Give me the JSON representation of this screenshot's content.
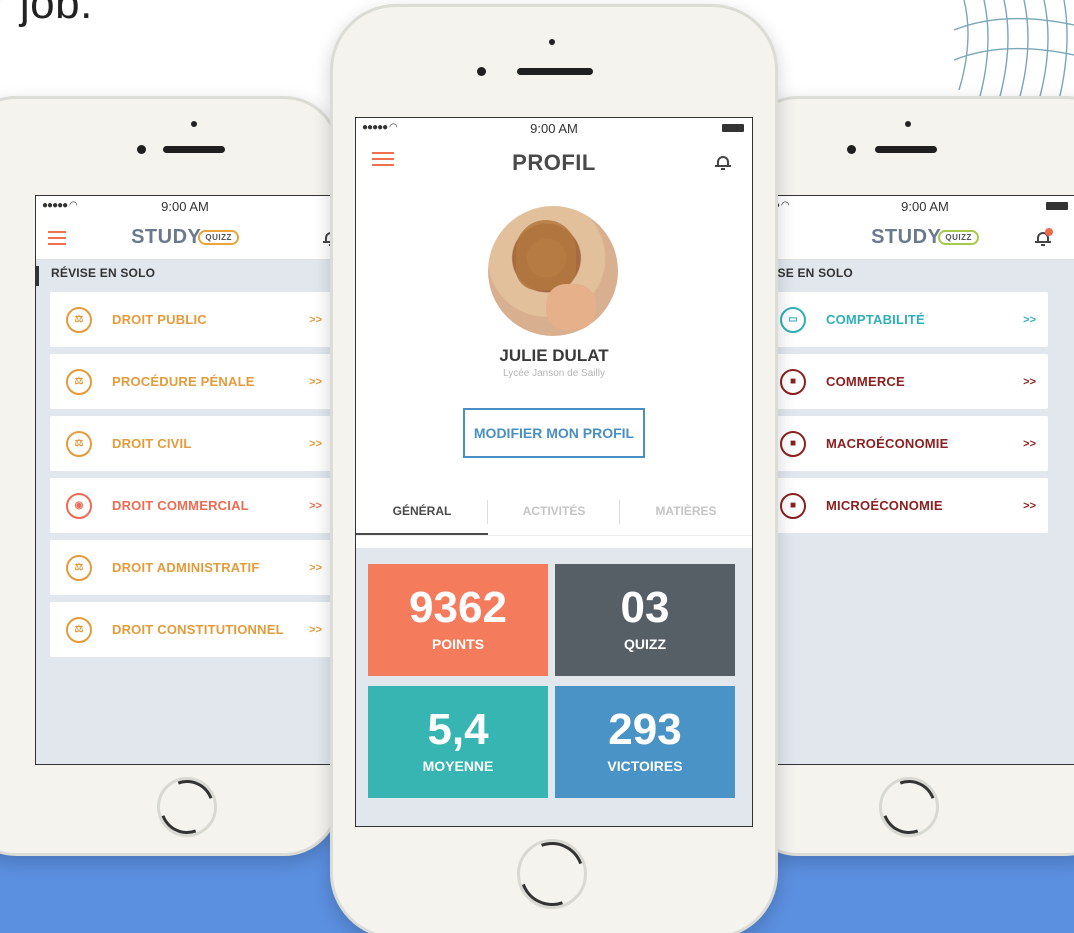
{
  "background": {
    "headline": "r job."
  },
  "colors": {
    "orange": "#e39b3c",
    "coral": "#ef6a52",
    "teal": "#2fb0b8",
    "maroon": "#8c2020",
    "blue": "#4a8fc4",
    "dark": "#565e66"
  },
  "left_phone": {
    "status_time": "9:00 AM",
    "logo": "STUDY",
    "logo_badge": "QUIZZ",
    "section_title": "RÉVISE EN SOLO",
    "items": [
      {
        "label": "DROIT PUBLIC",
        "icon": "scales-icon",
        "chevron": ">>"
      },
      {
        "label": "PROCÉDURE PÉNALE",
        "icon": "scales-icon",
        "chevron": ">>"
      },
      {
        "label": "DROIT CIVIL",
        "icon": "scales-icon",
        "chevron": ">>"
      },
      {
        "label": "DROIT COMMERCIAL",
        "icon": "globe-icon",
        "chevron": ">>"
      },
      {
        "label": "DROIT ADMINISTRATIF",
        "icon": "scales-icon",
        "chevron": ">>"
      },
      {
        "label": "DROIT CONSTITUTIONNEL",
        "icon": "scales-icon",
        "chevron": ">>"
      }
    ]
  },
  "center_phone": {
    "status_time": "9:00 AM",
    "title": "PROFIL",
    "name": "JULIE DULAT",
    "school": "Lycée Janson de Sailly",
    "edit_button": "MODIFIER MON PROFIL",
    "tabs": [
      {
        "label": "GÉNÉRAL"
      },
      {
        "label": "ACTIVITÉS"
      },
      {
        "label": "MATIÈRES"
      }
    ],
    "stats": [
      {
        "value": "9362",
        "label": "POINTS",
        "color": "#f47b5b"
      },
      {
        "value": "03",
        "label": "QUIZZ",
        "color": "#565e66"
      },
      {
        "value": "5,4",
        "label": "MOYENNE",
        "color": "#36b5b3"
      },
      {
        "value": "293",
        "label": "VICTOIRES",
        "color": "#4a93c6"
      }
    ]
  },
  "right_phone": {
    "status_time": "9:00 AM",
    "logo": "STUDY",
    "logo_badge": "QUIZZ",
    "section_title": "ISE EN SOLO",
    "items": [
      {
        "label": "COMPTABILITÉ",
        "icon": "ruler-icon",
        "chevron": ">>"
      },
      {
        "label": "COMMERCE",
        "icon": "briefcase-icon",
        "chevron": ">>"
      },
      {
        "label": "MACROÉCONOMIE",
        "icon": "briefcase-icon",
        "chevron": ">>"
      },
      {
        "label": "MICROÉCONOMIE",
        "icon": "briefcase-icon",
        "chevron": ">>"
      }
    ]
  }
}
